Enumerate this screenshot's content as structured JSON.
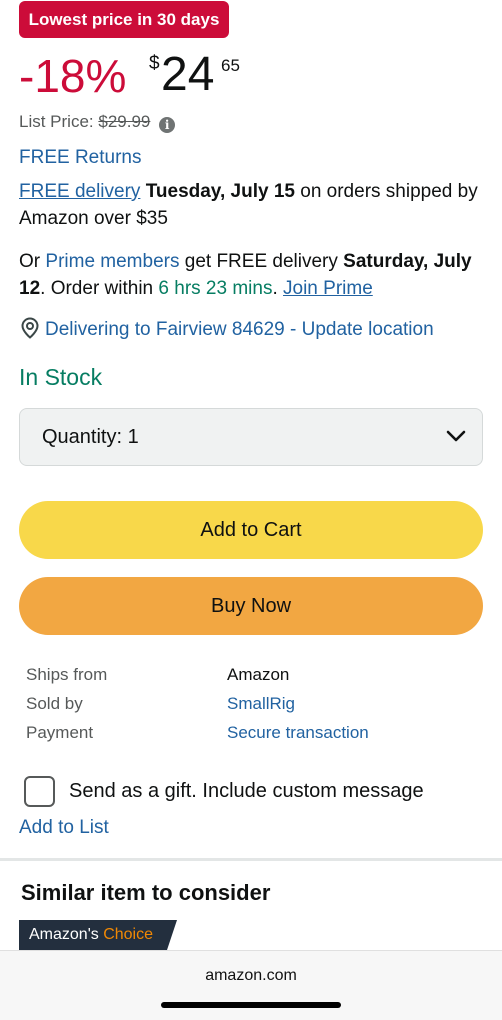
{
  "badge": {
    "label": "Lowest price in 30 days"
  },
  "price": {
    "discount": "-18%",
    "currency": "$",
    "whole": "24",
    "fraction": "65",
    "list_label": "List Price:",
    "list_value": "$29.99",
    "info_icon": "info-icon"
  },
  "returns": {
    "label": "FREE Returns"
  },
  "delivery": {
    "link": "FREE delivery",
    "date": "Tuesday, July 15",
    "suffix": "on orders shipped by Amazon over $35"
  },
  "prime": {
    "prefix": "Or",
    "link": "Prime members",
    "middle": "get FREE delivery",
    "date": "Saturday, July 12",
    "order_within": "Order within",
    "countdown": "6 hrs 23 mins",
    "join": "Join Prime"
  },
  "location": {
    "label": "Delivering to Fairview 84629 - Update location",
    "icon": "location-pin-icon"
  },
  "stock": {
    "label": "In Stock"
  },
  "quantity": {
    "label": "Quantity:",
    "value": "1",
    "icon": "chevron-down-icon"
  },
  "buttons": {
    "add_to_cart": "Add to Cart",
    "buy_now": "Buy Now"
  },
  "details": [
    {
      "key": "Ships from",
      "value": "Amazon",
      "is_link": false
    },
    {
      "key": "Sold by",
      "value": "SmallRig",
      "is_link": true
    },
    {
      "key": "Payment",
      "value": "Secure transaction",
      "is_link": true
    }
  ],
  "gift": {
    "label": "Send as a gift. Include custom message",
    "checked": false
  },
  "add_to_list": "Add to List",
  "similar": {
    "title": "Similar item to consider"
  },
  "choice_badge": {
    "prefix": "Amazon's",
    "highlight": "Choice"
  },
  "browser": {
    "url": "amazon.com"
  },
  "colors": {
    "deal_red": "#cc0c39",
    "link_blue": "#2162a1",
    "stock_green": "#067d62",
    "cart_yellow": "#f8d84a",
    "buy_orange": "#f2a742",
    "choice_orange": "#f08804",
    "choice_navy": "#232f3e"
  }
}
